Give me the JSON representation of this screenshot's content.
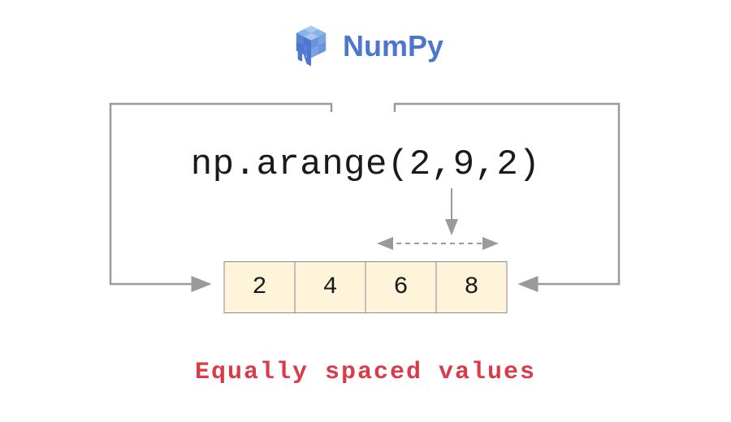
{
  "logo": {
    "text": "NumPy"
  },
  "code": {
    "expression": "np.arange(2,9,2)"
  },
  "array": {
    "values": [
      "2",
      "4",
      "6",
      "8"
    ]
  },
  "caption": "Equally spaced values",
  "colors": {
    "logo_blue": "#4d77cf",
    "logo_light": "#87b3e6",
    "cell_bg": "#fdf4d9",
    "caption_red": "#d93b4a",
    "arrow_gray": "#9a9a9a"
  }
}
